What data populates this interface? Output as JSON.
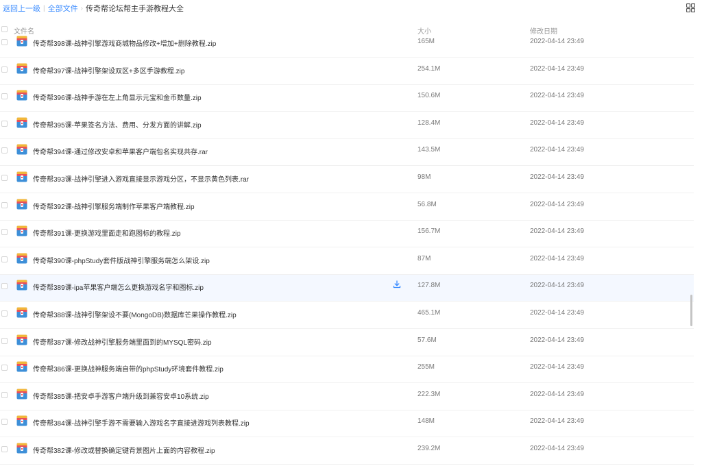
{
  "breadcrumb": {
    "back": "返回上一级",
    "all_files": "全部文件",
    "current": "传奇帮论坛帮主手游教程大全"
  },
  "table_header": {
    "name": "文件名",
    "size": "大小",
    "date": "修改日期"
  },
  "icons": {
    "file": "zip-archive-icon",
    "download": "download-icon",
    "view": "grid-view-icon"
  },
  "colors": {
    "link": "#3b8cff",
    "hover_row": "#f4f8ff"
  },
  "files": [
    {
      "name": "传奇帮398课-战神引擎游戏商城物品修改+增加+删除教程.zip",
      "size": "165M",
      "date": "2022-04-14 23:49"
    },
    {
      "name": "传奇帮397课-战神引擎架设双区+多区手游教程.zip",
      "size": "254.1M",
      "date": "2022-04-14 23:49"
    },
    {
      "name": "传奇帮396课-战神手游在左上角显示元宝和金币数量.zip",
      "size": "150.6M",
      "date": "2022-04-14 23:49"
    },
    {
      "name": "传奇帮395课-苹果签名方法、费用、分发方面的讲解.zip",
      "size": "128.4M",
      "date": "2022-04-14 23:49"
    },
    {
      "name": "传奇帮394课-通过修改安卓和苹果客户端包名实现共存.rar",
      "size": "143.5M",
      "date": "2022-04-14 23:49"
    },
    {
      "name": "传奇帮393课-战神引擎进入游戏直接显示游戏分区，不显示黄色列表.rar",
      "size": "98M",
      "date": "2022-04-14 23:49"
    },
    {
      "name": "传奇帮392课-战神引擎服务端制作苹果客户端教程.zip",
      "size": "56.8M",
      "date": "2022-04-14 23:49"
    },
    {
      "name": "传奇帮391课-更换游戏里面走和跑图标的教程.zip",
      "size": "156.7M",
      "date": "2022-04-14 23:49"
    },
    {
      "name": "传奇帮390课-phpStudy套件版战神引擎服务端怎么架设.zip",
      "size": "87M",
      "date": "2022-04-14 23:49"
    },
    {
      "name": "传奇帮389课-ipa苹果客户端怎么更换游戏名字和图标.zip",
      "size": "127.8M",
      "date": "2022-04-14 23:49"
    },
    {
      "name": "传奇帮388课-战神引擎架设不要(MongoDB)数据库芒果操作教程.zip",
      "size": "465.1M",
      "date": "2022-04-14 23:49"
    },
    {
      "name": "传奇帮387课-修改战神引擎服务端里面到的MYSQL密码.zip",
      "size": "57.6M",
      "date": "2022-04-14 23:49"
    },
    {
      "name": "传奇帮386课-更换战神服务端自带的phpStudy环境套件教程.zip",
      "size": "255M",
      "date": "2022-04-14 23:49"
    },
    {
      "name": "传奇帮385课-把安卓手游客户端升级到兼容安卓10系统.zip",
      "size": "222.3M",
      "date": "2022-04-14 23:49"
    },
    {
      "name": "传奇帮384课-战神引擎手游不需要输入游戏名字直接进游戏列表教程.zip",
      "size": "148M",
      "date": "2022-04-14 23:49"
    },
    {
      "name": "传奇帮382课-修改或替换确定键背景图片上面的内容教程.zip",
      "size": "239.2M",
      "date": "2022-04-14 23:49"
    }
  ]
}
